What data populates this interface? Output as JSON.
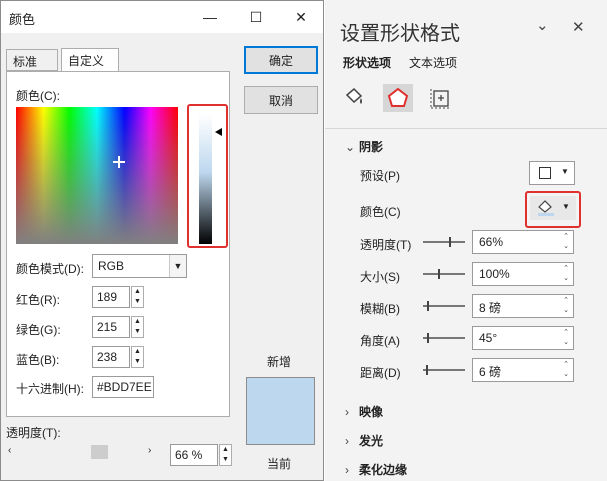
{
  "dialog": {
    "title": "颜色",
    "win_min": "—",
    "win_max": "☐",
    "win_close": "✕",
    "tabs": [
      "标准",
      "自定义"
    ],
    "colors_label": "颜色(C):",
    "color_model_label": "颜色模式(D):",
    "color_model_value": "RGB",
    "red_label": "红色(R):",
    "red_value": "189",
    "green_label": "绿色(G):",
    "green_value": "215",
    "blue_label": "蓝色(B):",
    "blue_value": "238",
    "hex_label": "十六进制(H):",
    "hex_value": "#BDD7EE",
    "transparency_label": "透明度(T):",
    "transparency_value": "66 %",
    "ok_label": "确定",
    "cancel_label": "取消",
    "new_label": "新增",
    "current_label": "当前",
    "new_color": "#bdd7ee"
  },
  "pane": {
    "title": "设置形状格式",
    "tabs": [
      "形状选项",
      "文本选项"
    ],
    "icons": [
      "fill-line-icon",
      "effects-icon",
      "size-properties-icon"
    ],
    "sections": {
      "shadow": "阴影",
      "reflection": "映像",
      "glow": "发光",
      "soft_edges": "柔化边缘"
    },
    "rows": {
      "preset_label": "预设(P)",
      "color_label": "颜色(C)",
      "transparency_label": "透明度(T)",
      "transparency_value": "66%",
      "size_label": "大小(S)",
      "size_value": "100%",
      "blur_label": "模糊(B)",
      "blur_value": "8 磅",
      "angle_label": "角度(A)",
      "angle_value": "45°",
      "distance_label": "距离(D)",
      "distance_value": "6 磅"
    },
    "accent": "#e0302e"
  }
}
